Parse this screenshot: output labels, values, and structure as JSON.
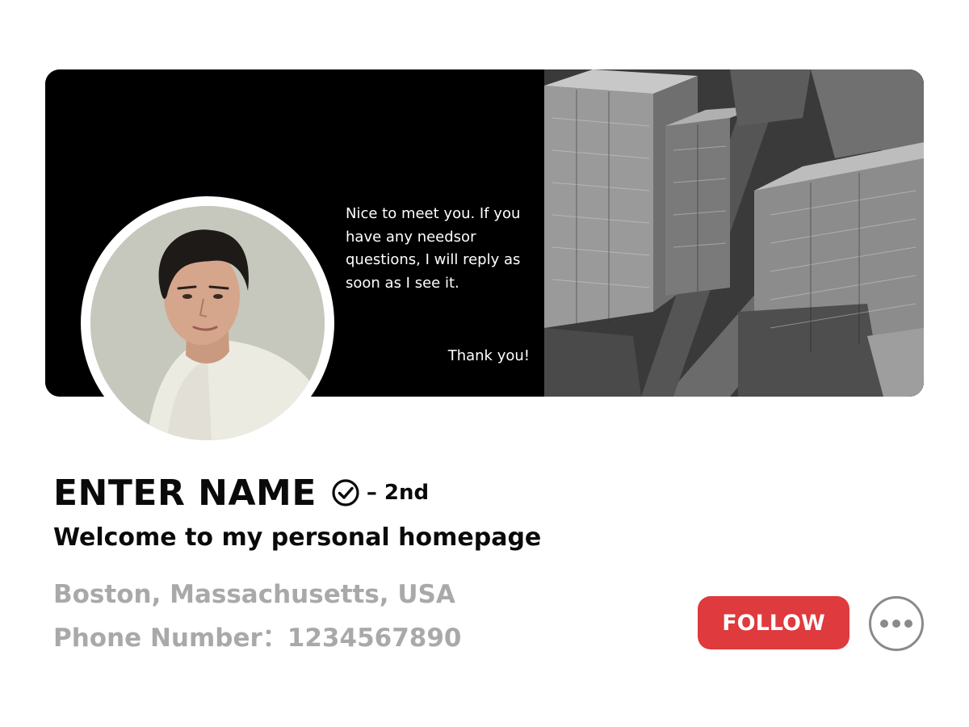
{
  "banner": {
    "message": "Nice to meet you. If you have any needsor questions, I will reply as soon as I see it.",
    "thanks": "Thank you!"
  },
  "profile": {
    "name": "ENTER NAME",
    "degree": "– 2nd",
    "headline": "Welcome to my personal homepage",
    "location": "Boston, Massachusetts, USA",
    "phone": "Phone Number：1234567890",
    "verified_icon": "check-circle-icon"
  },
  "actions": {
    "follow_label": "FOLLOW",
    "follow_color": "#df3a3d",
    "more_icon": "more-horizontal-icon"
  },
  "colors": {
    "text_dark": "#0a0a0a",
    "text_muted": "#a9a9a9",
    "banner_bg": "#000000"
  }
}
